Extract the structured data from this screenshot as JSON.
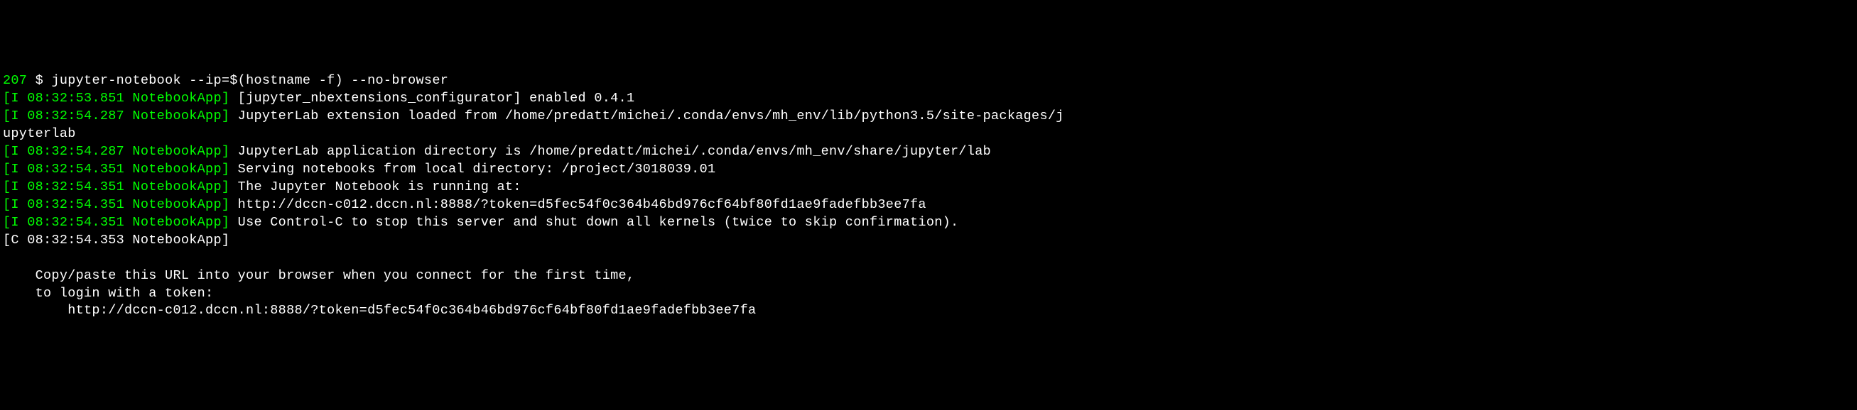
{
  "prompt": {
    "number": "207",
    "symbol": "$",
    "command": "jupyter-notebook --ip=$(hostname -f) --no-browser"
  },
  "lines": [
    {
      "prefix": "[I 08:32:53.851 NotebookApp]",
      "message": " [jupyter_nbextensions_configurator] enabled 0.4.1",
      "type": "info"
    },
    {
      "prefix": "[I 08:32:54.287 NotebookApp]",
      "message": " JupyterLab extension loaded from /home/predatt/michei/.conda/envs/mh_env/lib/python3.5/site-packages/j",
      "type": "info"
    },
    {
      "prefix": "",
      "message": "upyterlab",
      "type": "wrap"
    },
    {
      "prefix": "[I 08:32:54.287 NotebookApp]",
      "message": " JupyterLab application directory is /home/predatt/michei/.conda/envs/mh_env/share/jupyter/lab",
      "type": "info"
    },
    {
      "prefix": "[I 08:32:54.351 NotebookApp]",
      "message": " Serving notebooks from local directory: /project/3018039.01",
      "type": "info"
    },
    {
      "prefix": "[I 08:32:54.351 NotebookApp]",
      "message": " The Jupyter Notebook is running at:",
      "type": "info"
    },
    {
      "prefix": "[I 08:32:54.351 NotebookApp]",
      "message": " http://dccn-c012.dccn.nl:8888/?token=d5fec54f0c364b46bd976cf64bf80fd1ae9fadefbb3ee7fa",
      "type": "info"
    },
    {
      "prefix": "[I 08:32:54.351 NotebookApp]",
      "message": " Use Control-C to stop this server and shut down all kernels (twice to skip confirmation).",
      "type": "info"
    },
    {
      "prefix": "[C 08:32:54.353 NotebookApp]",
      "message": "",
      "type": "critical"
    },
    {
      "prefix": "",
      "message": "",
      "type": "blank"
    },
    {
      "prefix": "",
      "message": "    Copy/paste this URL into your browser when you connect for the first time,",
      "type": "plain"
    },
    {
      "prefix": "",
      "message": "    to login with a token:",
      "type": "plain"
    },
    {
      "prefix": "",
      "message": "        http://dccn-c012.dccn.nl:8888/?token=d5fec54f0c364b46bd976cf64bf80fd1ae9fadefbb3ee7fa",
      "type": "plain"
    }
  ]
}
